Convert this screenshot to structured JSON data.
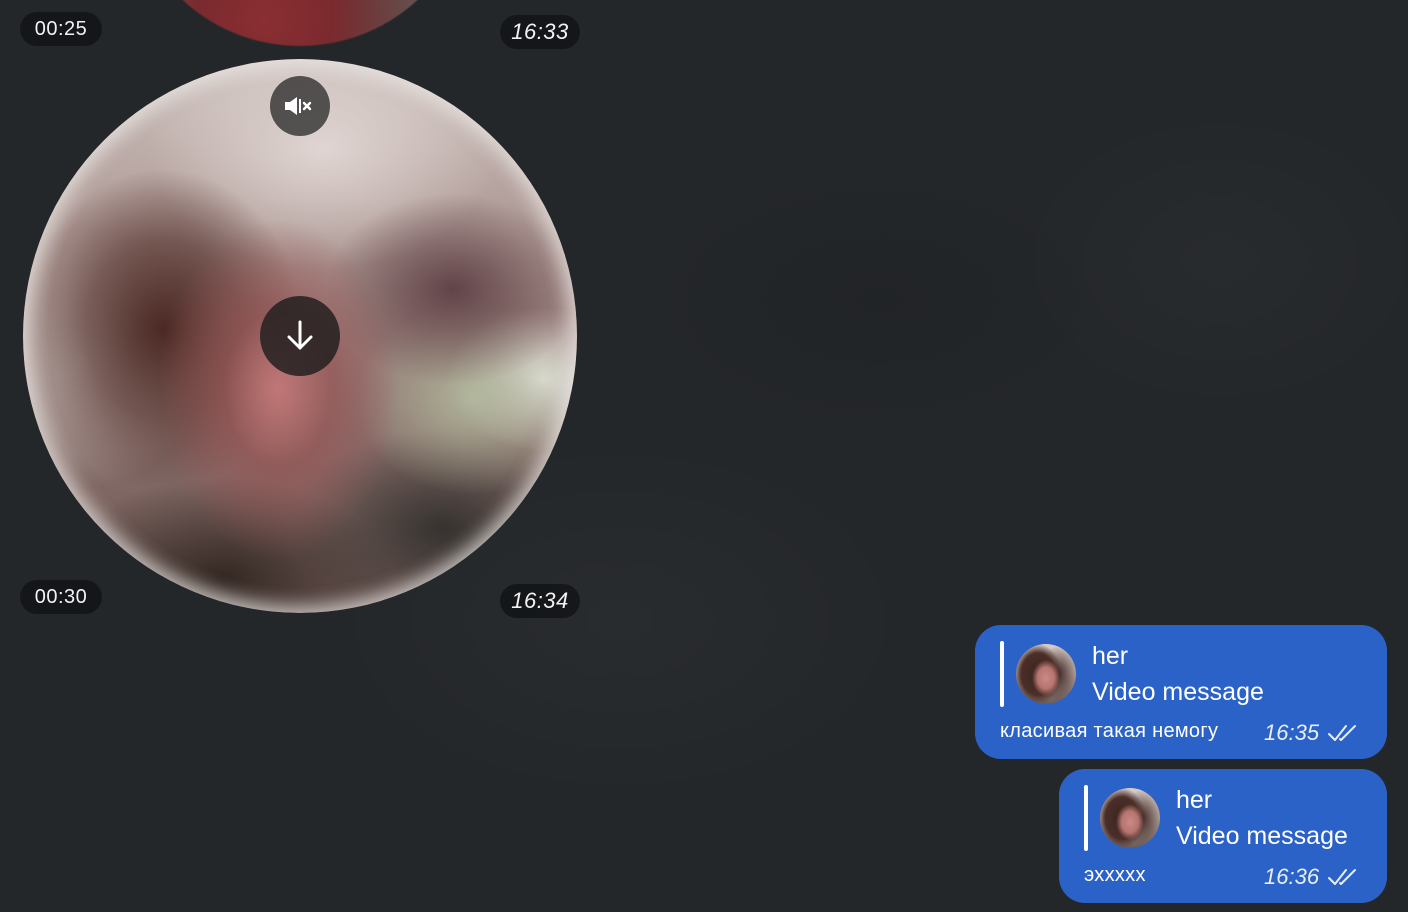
{
  "videos": [
    {
      "duration": "00:25",
      "time": "16:33"
    },
    {
      "duration": "00:30",
      "time": "16:34"
    }
  ],
  "icons": {
    "mute": "muted-speaker-icon",
    "download": "download-arrow-icon",
    "read": "double-check-icon"
  },
  "messages": [
    {
      "reply_name": "her",
      "reply_text": "Video message",
      "text": "класивая такая немогу",
      "time": "16:35"
    },
    {
      "reply_name": "her",
      "reply_text": "Video message",
      "text": "эххххх",
      "time": "16:36"
    }
  ],
  "colors": {
    "background": "#24272a",
    "outgoing_bubble": "#2b62c8",
    "pill": "#121416"
  }
}
